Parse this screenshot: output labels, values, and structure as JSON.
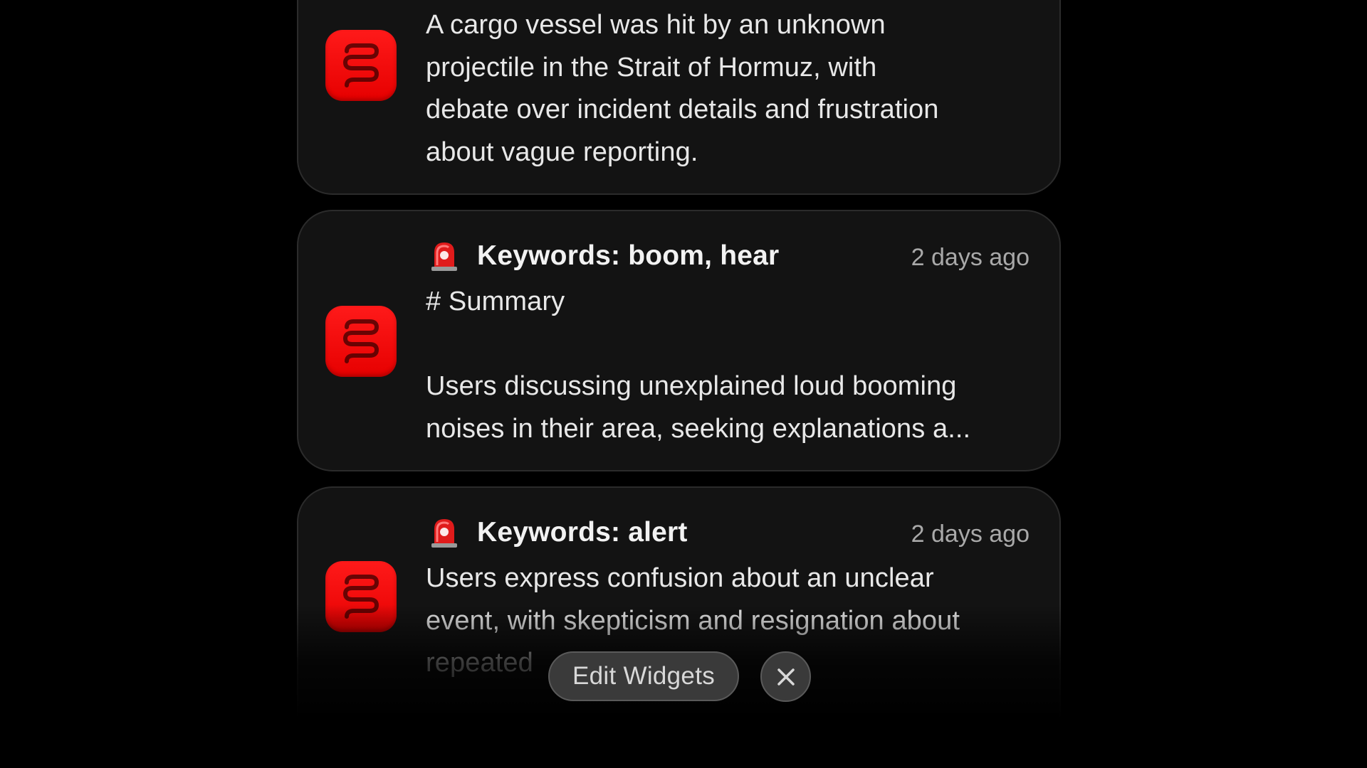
{
  "notifications": [
    {
      "title": "",
      "time": "",
      "lines": [
        "A cargo vessel was hit by an unknown",
        "projectile in the Strait of Hormuz, with",
        "debate over incident details and frustration",
        "about vague reporting."
      ]
    },
    {
      "title": "Keywords: boom, hear",
      "time": "2 days ago",
      "heading": "# Summary",
      "lines": [
        "Users discussing unexplained loud booming",
        "noises in their area, seeking explanations a..."
      ]
    },
    {
      "title": "Keywords: alert",
      "time": "2 days ago",
      "lines": [
        "Users express confusion about an unclear",
        "event, with skepticism and resignation about",
        "repeated"
      ]
    }
  ],
  "toolbar": {
    "edit_label": "Edit Widgets",
    "close_icon": "close-icon"
  },
  "colors": {
    "app_icon": "#ff1a1a",
    "card_bg": "#131313",
    "background": "#000000"
  },
  "icons": {
    "app": "app-logo-icon",
    "alarm": "rotating-light-icon"
  }
}
